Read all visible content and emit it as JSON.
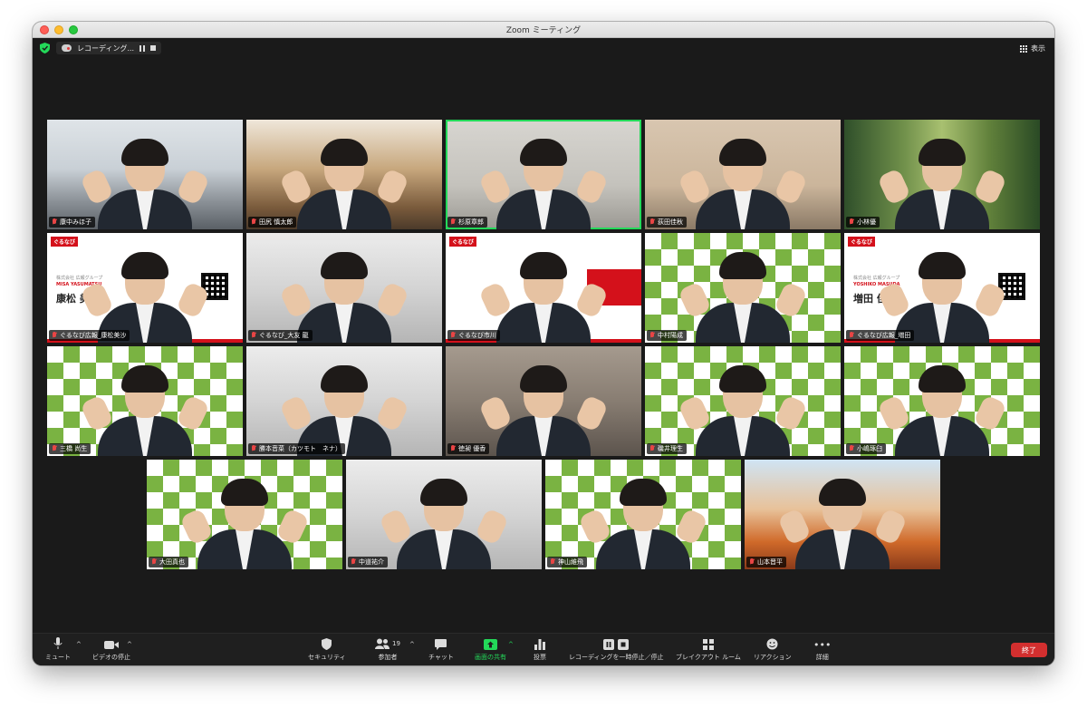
{
  "window": {
    "title": "Zoom ミーティング"
  },
  "topbar": {
    "recording_label": "レコーディング...",
    "view_label": "表示"
  },
  "participants": [
    {
      "name": "康中みほ子",
      "bg": "office"
    },
    {
      "name": "田尻 慎太郎",
      "bg": "lib"
    },
    {
      "name": "杉原章郎",
      "bg": "plain",
      "active": true
    },
    {
      "name": "荻田佳秋",
      "bg": "warm"
    },
    {
      "name": "小林優",
      "bg": "forest"
    },
    {
      "name": "ぐるなび広報_康松美沙",
      "bg": "brand",
      "card_roman": "MISA YASUMATSU",
      "card_kanji": "康松 美",
      "card_sub": "株式会社 広報グループ"
    },
    {
      "name": "ぐるなび_大友 龍",
      "bg": "room"
    },
    {
      "name": "ぐるなび市川",
      "bg": "brand2"
    },
    {
      "name": "中村陽成",
      "bg": "check"
    },
    {
      "name": "ぐるなび広報_増田",
      "bg": "brand",
      "card_roman": "YOSHIKO MASUDA",
      "card_kanji": "増田 佳子",
      "card_sub": "株式会社 広報グループ"
    },
    {
      "name": "三橋 尚生",
      "bg": "check"
    },
    {
      "name": "勝本音菜（カツモト　ネナ）",
      "bg": "room"
    },
    {
      "name": "徳昶 優香",
      "bg": "dark"
    },
    {
      "name": "磯井理生",
      "bg": "check"
    },
    {
      "name": "小嶋琢臼",
      "bg": "check"
    },
    {
      "name": "大田真也",
      "bg": "check"
    },
    {
      "name": "中道祐介",
      "bg": "room"
    },
    {
      "name": "神山維飛",
      "bg": "check"
    },
    {
      "name": "山本晋平",
      "bg": "shrine"
    }
  ],
  "brand": {
    "logo": "ぐるなび"
  },
  "toolbar": {
    "mute": "ミュート",
    "video": "ビデオの停止",
    "security": "セキュリティ",
    "participants": "参加者",
    "participants_count": "19",
    "chat": "チャット",
    "share": "画面の共有",
    "polls": "投票",
    "recording": "レコーディングを一時停止／停止",
    "breakout": "ブレイクアウト ルーム",
    "reactions": "リアクション",
    "more": "詳細",
    "end": "終了"
  },
  "colors": {
    "share_green": "#23d959",
    "end_red": "#d32f2f",
    "brand_red": "#d4111b",
    "muted_red": "#e84545"
  }
}
